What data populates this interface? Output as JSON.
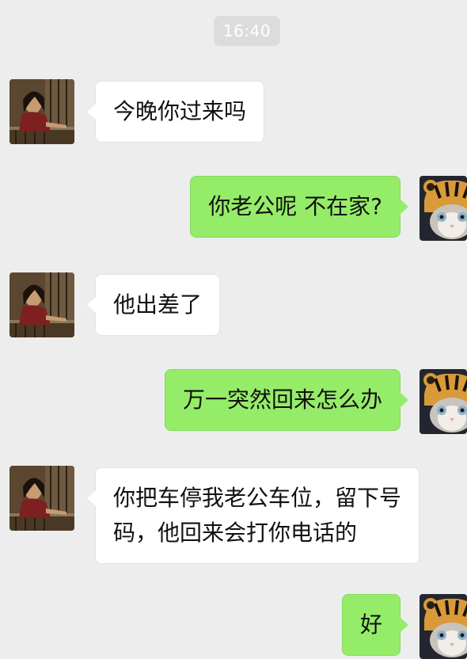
{
  "timestamp": "16:40",
  "colors": {
    "background": "#ededed",
    "received_bubble": "#ffffff",
    "sent_bubble": "#95ec69"
  },
  "messages": [
    {
      "sender": "contact",
      "text": "今晚你过来吗"
    },
    {
      "sender": "me",
      "text": "你老公呢 不在家?"
    },
    {
      "sender": "contact",
      "text": "他出差了"
    },
    {
      "sender": "me",
      "text": "万一突然回来怎么办"
    },
    {
      "sender": "contact",
      "lines": [
        "你把车停我老公车位，留下号",
        "码，他回来会打你电话的"
      ]
    },
    {
      "sender": "me",
      "text": "好"
    }
  ],
  "avatars": {
    "contact": "woman-at-window-photo",
    "me": "cat-in-tiger-hat-photo"
  }
}
